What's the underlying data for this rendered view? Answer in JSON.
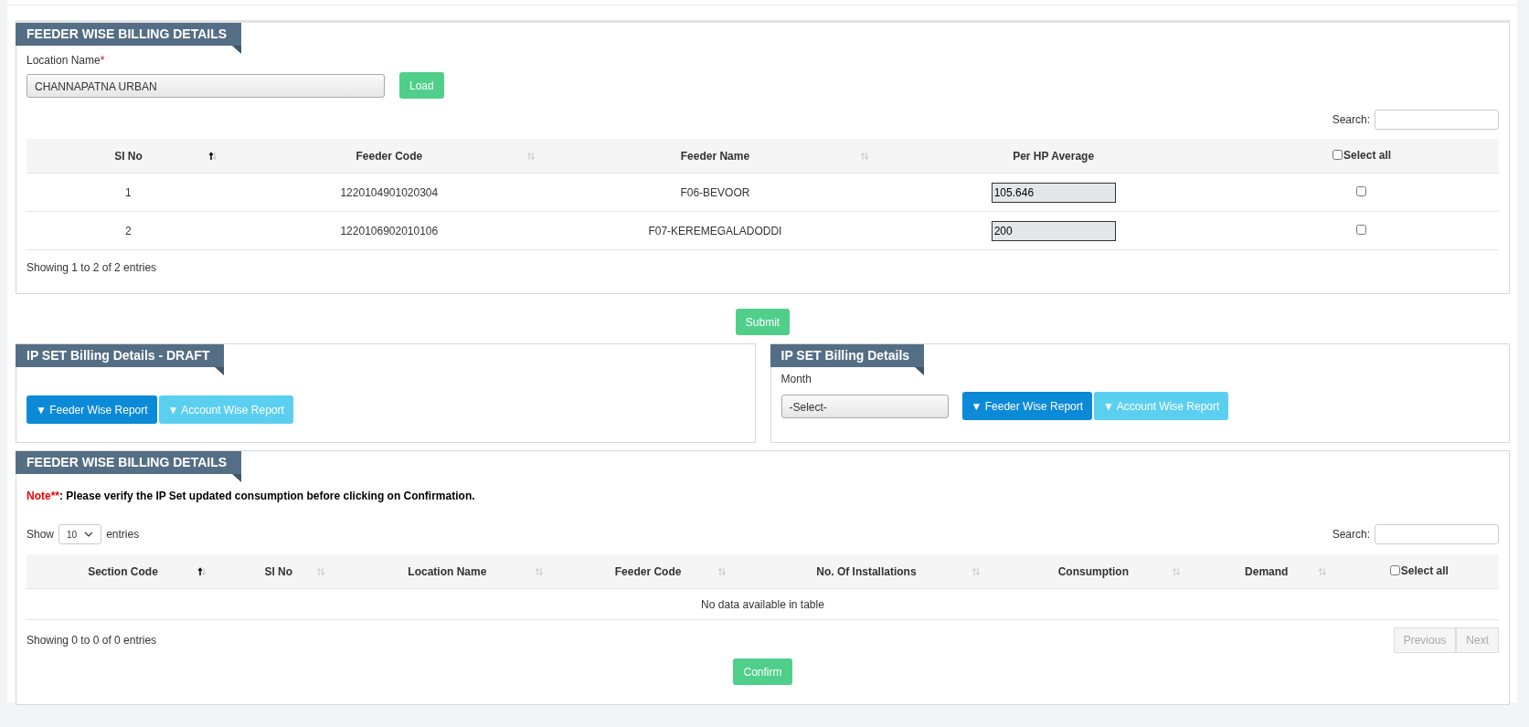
{
  "feeder_panel": {
    "title": "FEEDER WISE BILLING DETAILS",
    "location": {
      "label": "Location Name",
      "required_mark": "*",
      "value": "CHANNAPATNA URBAN"
    },
    "load_button": "Load",
    "search_label": "Search:",
    "columns": [
      {
        "label": "SI No",
        "sortable": true,
        "sorted": true
      },
      {
        "label": "Feeder Code",
        "sortable": true,
        "sorted": false
      },
      {
        "label": "Feeder Name",
        "sortable": true,
        "sorted": false
      },
      {
        "label": "Per HP Average",
        "sortable": false
      },
      {
        "label": "Select all",
        "sortable": false,
        "kind": "checkbox",
        "checked": false
      }
    ],
    "rows": [
      {
        "si_no": "1",
        "feeder_code": "1220104901020304",
        "feeder_name": "F06-BEVOOR",
        "per_hp_average": "105.646",
        "checked": false
      },
      {
        "si_no": "2",
        "feeder_code": "1220106902010106",
        "feeder_name": "F07-KEREMEGALADODDI",
        "per_hp_average": "200",
        "checked": false
      }
    ],
    "info": "Showing 1 to 2 of 2 entries"
  },
  "submit_button": "Submit",
  "draft_panel": {
    "title": "IP SET Billing Details - DRAFT",
    "buttons": [
      {
        "label": "▼ Feeder Wise Report",
        "kind": "primary"
      },
      {
        "label": "▼ Account Wise Report",
        "kind": "info"
      }
    ]
  },
  "billing_panel": {
    "title": "IP SET Billing Details",
    "month": {
      "label": "Month",
      "value": "-Select-"
    },
    "buttons": [
      {
        "label": "▼ Feeder Wise Report",
        "kind": "primary"
      },
      {
        "label": "▼ Account Wise Report",
        "kind": "info"
      }
    ]
  },
  "report_panel": {
    "title": "FEEDER WISE BILLING DETAILS",
    "note_label": "Note**",
    "note_text": ": Please verify the IP Set updated consumption before clicking on Confirmation.",
    "show_label": "Show",
    "page_size": "10",
    "entries_label": "entries",
    "search_label": "Search:",
    "columns": [
      {
        "label": "Section Code",
        "sortable": true,
        "sorted": true
      },
      {
        "label": "SI No",
        "sortable": true,
        "sorted": false
      },
      {
        "label": "Location Name",
        "sortable": true,
        "sorted": false
      },
      {
        "label": "Feeder Code",
        "sortable": true,
        "sorted": false
      },
      {
        "label": "No. Of Installations",
        "sortable": true,
        "sorted": false
      },
      {
        "label": "Consumption",
        "sortable": true,
        "sorted": false
      },
      {
        "label": "Demand",
        "sortable": true,
        "sorted": false
      },
      {
        "label": "Select all",
        "sortable": false,
        "kind": "checkbox",
        "checked": false
      }
    ],
    "empty_text": "No data available in table",
    "info": "Showing 0 to 0 of 0 entries",
    "pagination": [
      {
        "label": "Previous",
        "disabled": true
      },
      {
        "label": "Next",
        "disabled": true
      }
    ],
    "confirm_button": "Confirm"
  }
}
